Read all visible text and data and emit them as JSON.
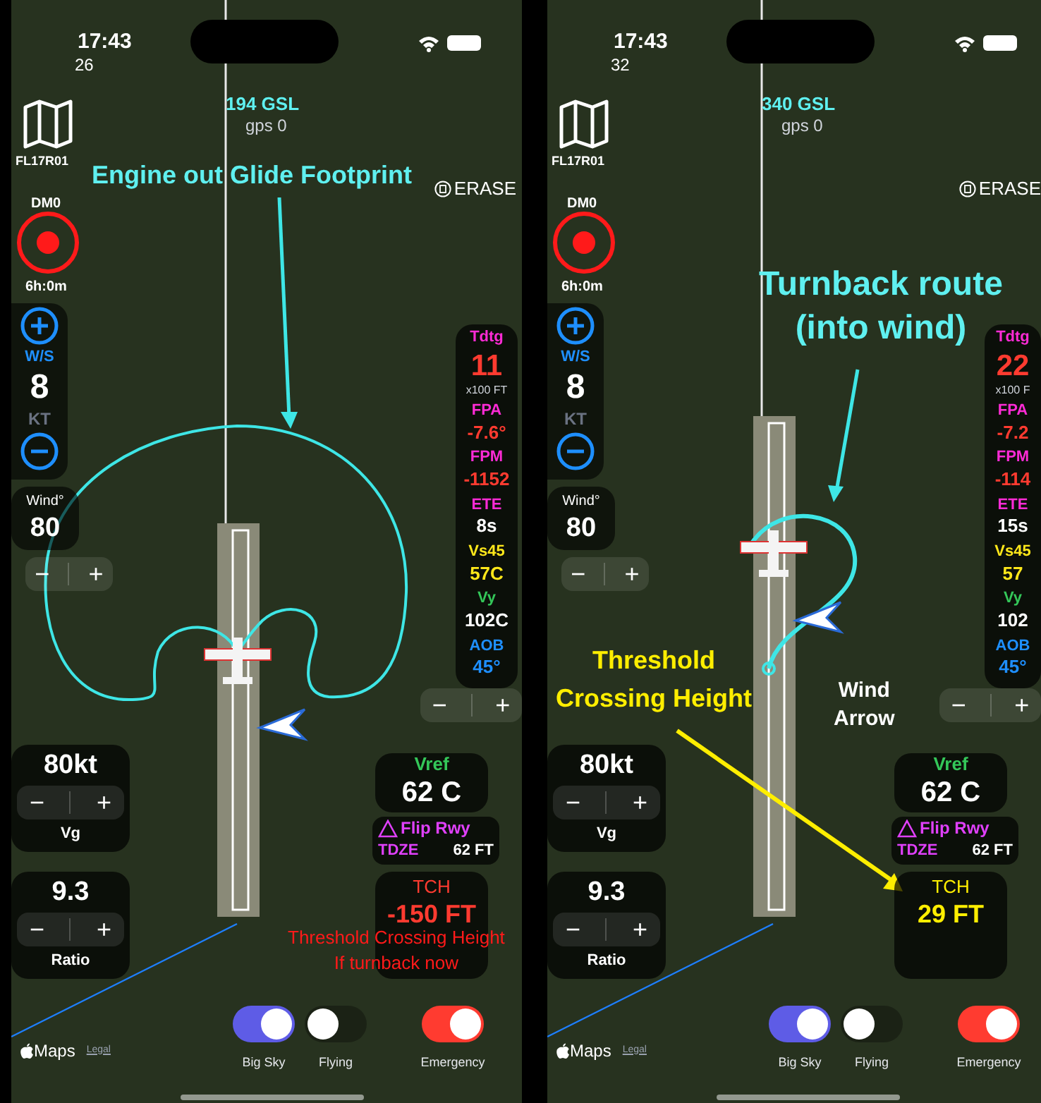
{
  "phones": [
    {
      "status": {
        "time": "17:43",
        "subtext": "26"
      },
      "gsl": "194 GSL",
      "gps": "gps 0",
      "map_button": "FL17R01",
      "erase": "ERASE",
      "dm": {
        "label": "DM0",
        "time": "6h:0m"
      },
      "wind_speed": {
        "label": "W/S",
        "value": "8",
        "unit": "KT"
      },
      "wind_dir": {
        "label": "Wind°",
        "value": "80"
      },
      "map_stepper": {
        "minus": "−",
        "plus": "+"
      },
      "stats": [
        {
          "label": "Tdtg",
          "value": "11",
          "unit": "x100 FT",
          "color": "#ff2bd6",
          "kind": "limit"
        },
        {
          "label": "FPA",
          "value": "-7.6°",
          "color": "#ff2bd6",
          "kind": "limit"
        },
        {
          "label": "FPM",
          "value": "-1152",
          "color": "#ff2bd6",
          "kind": "limit"
        },
        {
          "label": "ETE",
          "value": "8s",
          "color": "#ff2bd6",
          "kind": "plain"
        },
        {
          "label": "Vs45",
          "value": "57C",
          "color": "#ffe81a",
          "kind": "caution"
        },
        {
          "label": "Vy",
          "value": "102C",
          "color": "#34c759",
          "kind": "plain"
        },
        {
          "label": "AOB",
          "value": "45°",
          "color": "#1e8fff",
          "kind": "bank"
        }
      ],
      "stats_stepper": {
        "minus": "−",
        "plus": "+"
      },
      "vg": {
        "value": "80kt",
        "label": "Vg",
        "minus": "−",
        "plus": "+"
      },
      "ratio": {
        "value": "9.3",
        "label": "Ratio",
        "minus": "−",
        "plus": "+"
      },
      "vref": {
        "label": "Vref",
        "value": "62 C"
      },
      "flip": "Flip Rwy",
      "tdze": {
        "label": "TDZE",
        "value": "62 FT"
      },
      "tch": {
        "label": "TCH",
        "value": "-150 FT",
        "kind": "warning"
      },
      "toggles": [
        {
          "label": "Big Sky",
          "on": true,
          "color": "#5e5ce6"
        },
        {
          "label": "Flying",
          "on": false
        },
        {
          "label": "Emergency",
          "on": true,
          "color": "#ff3b30"
        }
      ],
      "attribution": {
        "maps": "Maps",
        "legal": "Legal"
      },
      "kind": "glide_footprint",
      "callouts": [
        {
          "kind": "glide",
          "lines": [
            "Engine out Glide Footprint"
          ]
        },
        {
          "kind": "tch_note",
          "lines": [
            "Threshold Crossing Height",
            "If turnback now"
          ]
        }
      ]
    },
    {
      "status": {
        "time": "17:43",
        "subtext": "32"
      },
      "gsl": "340 GSL",
      "gps": "gps 0",
      "map_button": "FL17R01",
      "erase": "ERASE",
      "dm": {
        "label": "DM0",
        "time": "6h:0m"
      },
      "wind_speed": {
        "label": "W/S",
        "value": "8",
        "unit": "KT"
      },
      "wind_dir": {
        "label": "Wind°",
        "value": "80"
      },
      "map_stepper": {
        "minus": "−",
        "plus": "+"
      },
      "stats": [
        {
          "label": "Tdtg",
          "value": "22",
          "unit": "x100 F",
          "color": "#ff2bd6",
          "kind": "limit"
        },
        {
          "label": "FPA",
          "value": "-7.2",
          "color": "#ff2bd6",
          "kind": "limit"
        },
        {
          "label": "FPM",
          "value": "-114",
          "color": "#ff2bd6",
          "kind": "limit"
        },
        {
          "label": "ETE",
          "value": "15s",
          "color": "#ff2bd6",
          "kind": "plain"
        },
        {
          "label": "Vs45",
          "value": "57",
          "color": "#ffe81a",
          "kind": "caution"
        },
        {
          "label": "Vy",
          "value": "102",
          "color": "#34c759",
          "kind": "plain"
        },
        {
          "label": "AOB",
          "value": "45°",
          "color": "#1e8fff",
          "kind": "bank"
        }
      ],
      "stats_stepper": {
        "minus": "−",
        "plus": "+"
      },
      "vg": {
        "value": "80kt",
        "label": "Vg",
        "minus": "−",
        "plus": "+"
      },
      "ratio": {
        "value": "9.3",
        "label": "Ratio",
        "minus": "−",
        "plus": "+"
      },
      "vref": {
        "label": "Vref",
        "value": "62 C"
      },
      "flip": "Flip Rwy",
      "tdze": {
        "label": "TDZE",
        "value": "62 FT"
      },
      "tch": {
        "label": "TCH",
        "value": "29 FT",
        "kind": "caution"
      },
      "toggles": [
        {
          "label": "Big Sky",
          "on": true,
          "color": "#5e5ce6"
        },
        {
          "label": "Flying",
          "on": false
        },
        {
          "label": "Emergency",
          "on": true,
          "color": "#ff3b30"
        }
      ],
      "attribution": {
        "maps": "Maps",
        "legal": "Legal"
      },
      "kind": "turnback",
      "callouts": [
        {
          "kind": "turnback",
          "lines": [
            "Turnback route",
            "(into wind)"
          ]
        },
        {
          "kind": "tch",
          "lines": [
            "Threshold",
            "Crossing Height"
          ]
        },
        {
          "kind": "wind",
          "lines": [
            "Wind",
            "Arrow"
          ]
        }
      ]
    }
  ]
}
